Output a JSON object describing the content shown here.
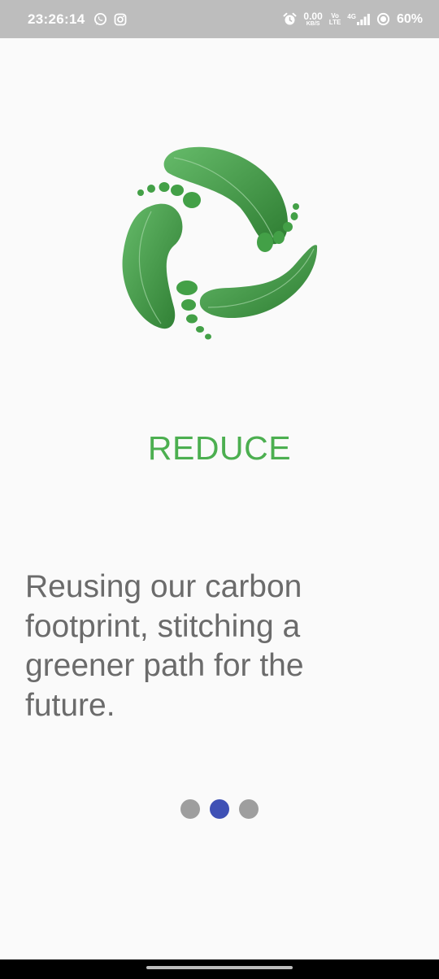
{
  "status_bar": {
    "time": "23:26:14",
    "net_speed_value": "0.00",
    "net_speed_unit": "KB/S",
    "volte_top": "Vo",
    "volte_bottom": "LTE",
    "network_type": "4G",
    "battery": "60%"
  },
  "onboarding": {
    "title": "REDUCE",
    "description": "Reusing our carbon footprint, stitching a greener path for the future.",
    "page_count": 3,
    "active_page": 2
  },
  "colors": {
    "title": "#4caf50",
    "active_dot": "#3f51b5",
    "inactive_dot": "#9e9e9e",
    "leaf": "#43a047"
  },
  "icons": {
    "status": [
      "whatsapp-icon",
      "instagram-icon",
      "alarm-icon",
      "signal-icon",
      "data-saver-icon"
    ],
    "logo": "carbon-footprint-leaf-logo"
  }
}
